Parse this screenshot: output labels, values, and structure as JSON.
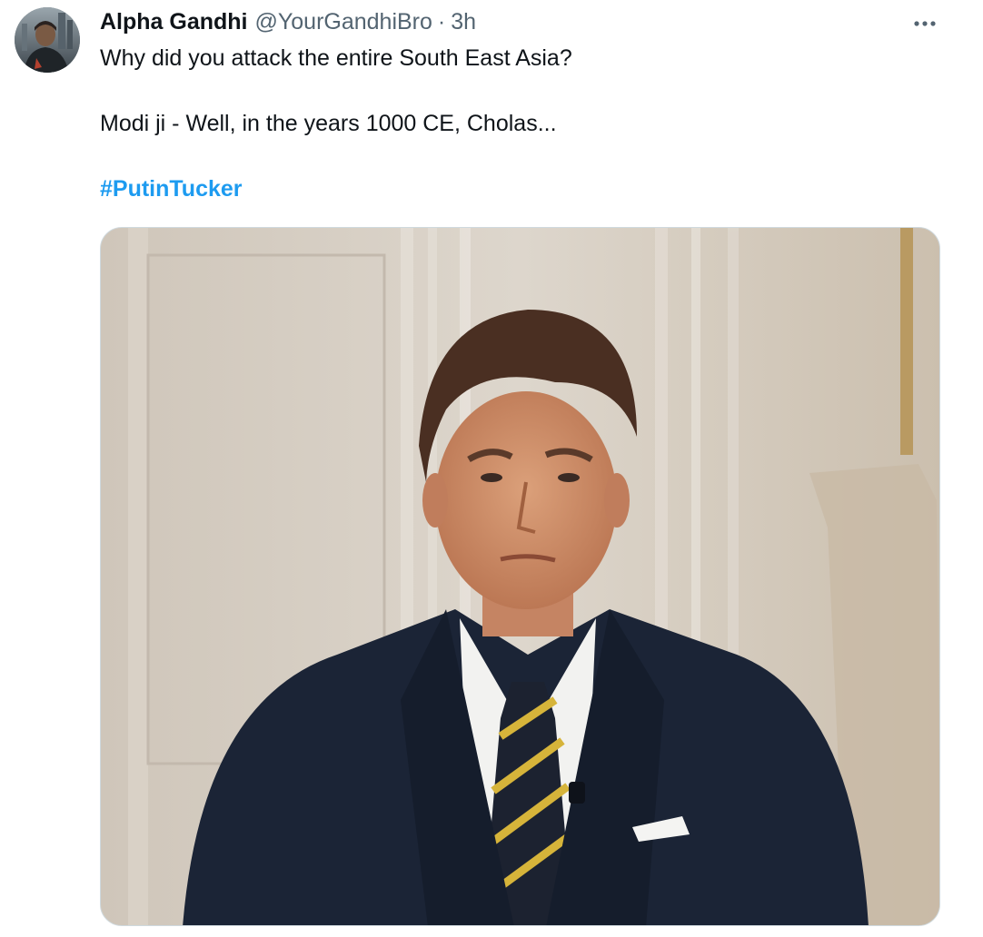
{
  "tweet": {
    "display_name": "Alpha Gandhi",
    "handle": "@YourGandhiBro",
    "separator": "·",
    "time": "3h",
    "more_label": "···",
    "text_line1": "Why did you attack the entire South East Asia?",
    "text_line2": "Modi ji - Well, in the years 1000 CE, Cholas...",
    "hashtag": "#PutinTucker"
  },
  "colors": {
    "text_primary": "#0f1419",
    "text_secondary": "#536471",
    "link": "#1d9bf0",
    "border": "#cfd9de"
  },
  "icons": {
    "more": "more-horizontal-icon"
  }
}
